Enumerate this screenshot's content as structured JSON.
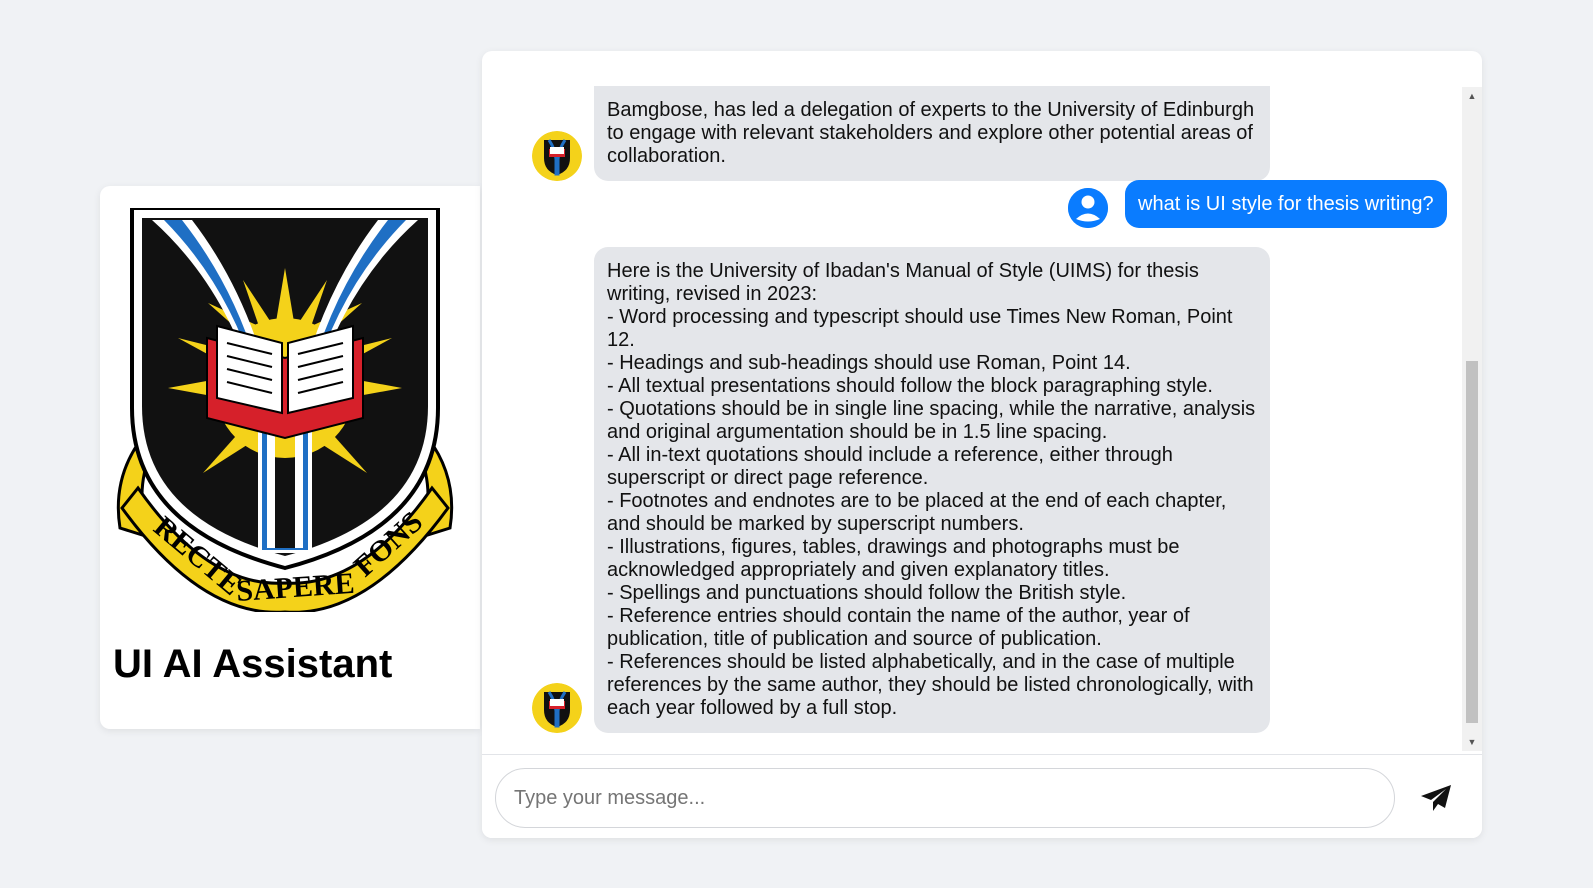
{
  "sidebar": {
    "app_title": "UI AI Assistant",
    "motto_words": [
      "RECTE",
      "SAPERE",
      "FONS"
    ]
  },
  "messages": [
    {
      "role": "bot",
      "text": "Bamgbose, has led a delegation of experts to the University of Edinburgh\nto engage with relevant stakeholders and explore other potential areas of\ncollaboration."
    },
    {
      "role": "user",
      "text": "what is UI style for thesis writing?"
    },
    {
      "role": "bot",
      "text": "Here is the University of Ibadan's Manual of Style (UIMS) for thesis\nwriting, revised in 2023:\n- Word processing and typescript should use Times New Roman, Point\n12.\n- Headings and sub-headings should use Roman, Point 14.\n- All textual presentations should follow the block paragraphing style.\n- Quotations should be in single line spacing, while the narrative, analysis\nand original argumentation should be in 1.5 line spacing.\n- All in-text quotations should include a reference, either through\nsuperscript or direct page reference.\n- Footnotes and endnotes are to be placed at the end of each chapter,\nand should be marked by superscript numbers.\n- Illustrations, figures, tables, drawings and photographs must be\nacknowledged appropriately and given explanatory titles.\n- Spellings and punctuations should follow the British style.\n- Reference entries should contain the name of the author, year of\npublication, title of publication and source of publication.\n- References should be listed alphabetically, and in the case of multiple\nreferences by the same author, they should be listed chronologically, with\neach year followed by a full stop."
    }
  ],
  "composer": {
    "placeholder": "Type your message...",
    "send_icon": "paper-plane-icon"
  },
  "colors": {
    "background": "#f0f2f5",
    "bot_bubble": "#e4e6ea",
    "user_bubble": "#0a7cff",
    "crest_shield": "#111111",
    "crest_gold": "#f4d21a",
    "crest_river": "#1f6fc4",
    "crest_book_red": "#d6202a"
  }
}
